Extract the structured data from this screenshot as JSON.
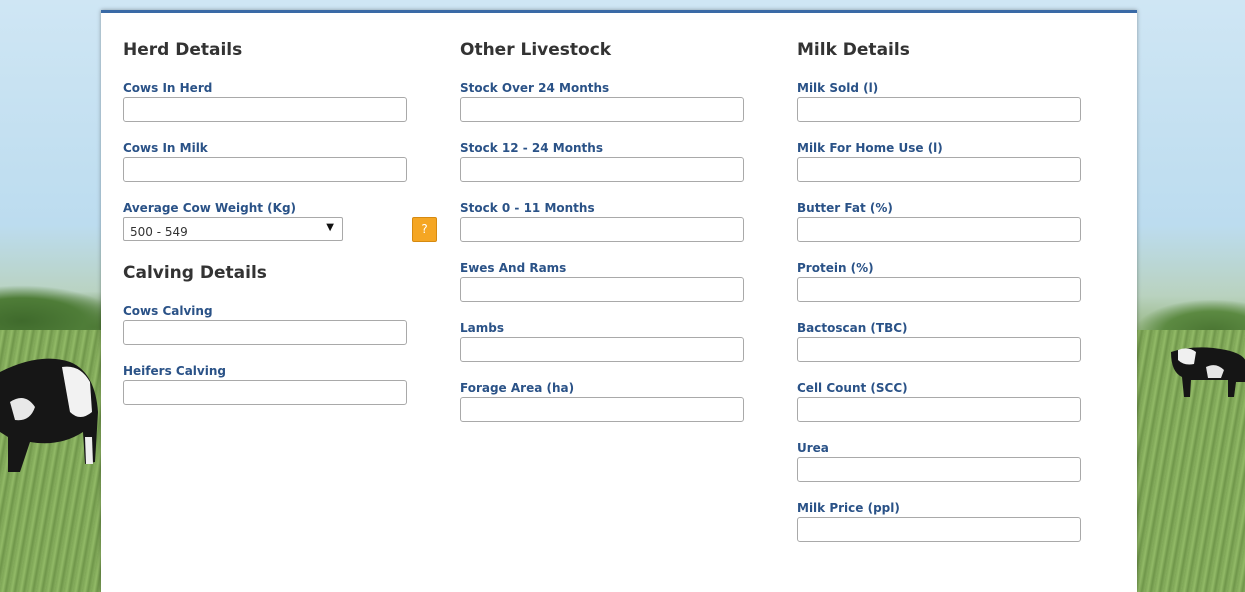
{
  "herd": {
    "title": "Herd Details",
    "cows_in_herd_label": "Cows In Herd",
    "cows_in_herd_value": "",
    "cows_in_milk_label": "Cows In Milk",
    "cows_in_milk_value": "",
    "avg_weight_label": "Average Cow Weight (Kg)",
    "avg_weight_selected": "500 - 549",
    "help_label": "?"
  },
  "calving": {
    "title": "Calving Details",
    "cows_calving_label": "Cows Calving",
    "cows_calving_value": "",
    "heifers_calving_label": "Heifers Calving",
    "heifers_calving_value": ""
  },
  "livestock": {
    "title": "Other Livestock",
    "stock_over_24_label": "Stock Over 24 Months",
    "stock_12_24_label": "Stock 12 - 24 Months",
    "stock_0_11_label": "Stock 0 - 11 Months",
    "ewes_rams_label": "Ewes And Rams",
    "lambs_label": "Lambs",
    "forage_area_label": "Forage Area (ha)"
  },
  "milk": {
    "title": "Milk Details",
    "milk_sold_label": "Milk Sold (l)",
    "milk_home_label": "Milk For Home Use (l)",
    "butter_fat_label": "Butter Fat (%)",
    "protein_label": "Protein (%)",
    "bactoscan_label": "Bactoscan (TBC)",
    "cell_count_label": "Cell Count (SCC)",
    "urea_label": "Urea",
    "milk_price_label": "Milk Price (ppl)"
  },
  "colors": {
    "accent": "#3a6aa6",
    "label": "#2a5287",
    "help_button": "#f5a623"
  }
}
